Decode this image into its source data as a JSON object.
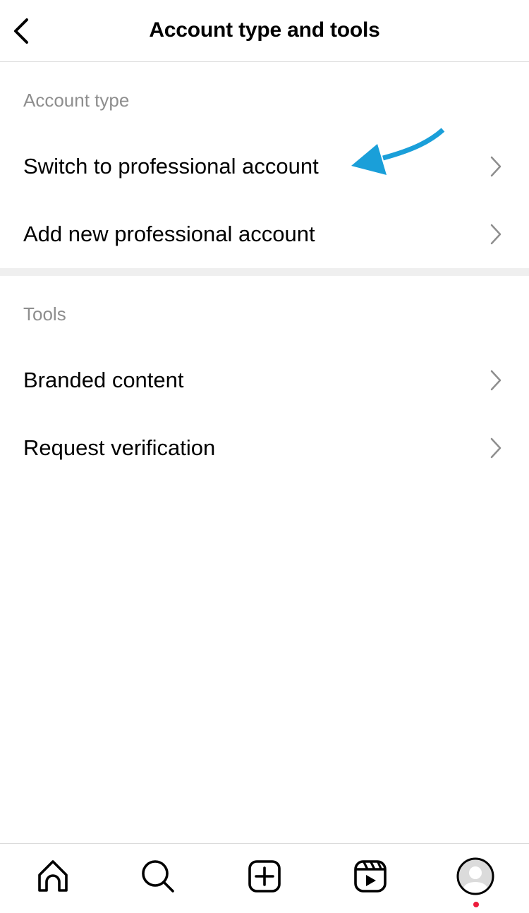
{
  "header": {
    "title": "Account type and tools",
    "back_icon": "chevron-left-icon"
  },
  "sections": [
    {
      "label": "Account type",
      "items": [
        {
          "label": "Switch to professional account",
          "icon": "chevron-right-icon",
          "highlighted": true
        },
        {
          "label": "Add new professional account",
          "icon": "chevron-right-icon"
        }
      ]
    },
    {
      "label": "Tools",
      "items": [
        {
          "label": "Branded content",
          "icon": "chevron-right-icon"
        },
        {
          "label": "Request verification",
          "icon": "chevron-right-icon"
        }
      ]
    }
  ],
  "annotation": {
    "type": "arrow",
    "color": "#1a9fd9",
    "points_to": "Switch to professional account"
  },
  "tabbar": {
    "tabs": [
      {
        "name": "home",
        "icon": "home-icon"
      },
      {
        "name": "search",
        "icon": "search-icon"
      },
      {
        "name": "create",
        "icon": "plus-square-icon"
      },
      {
        "name": "reels",
        "icon": "reels-icon"
      },
      {
        "name": "profile",
        "icon": "avatar-icon",
        "notification_dot": true,
        "dot_color": "#ed1c3c"
      }
    ]
  }
}
